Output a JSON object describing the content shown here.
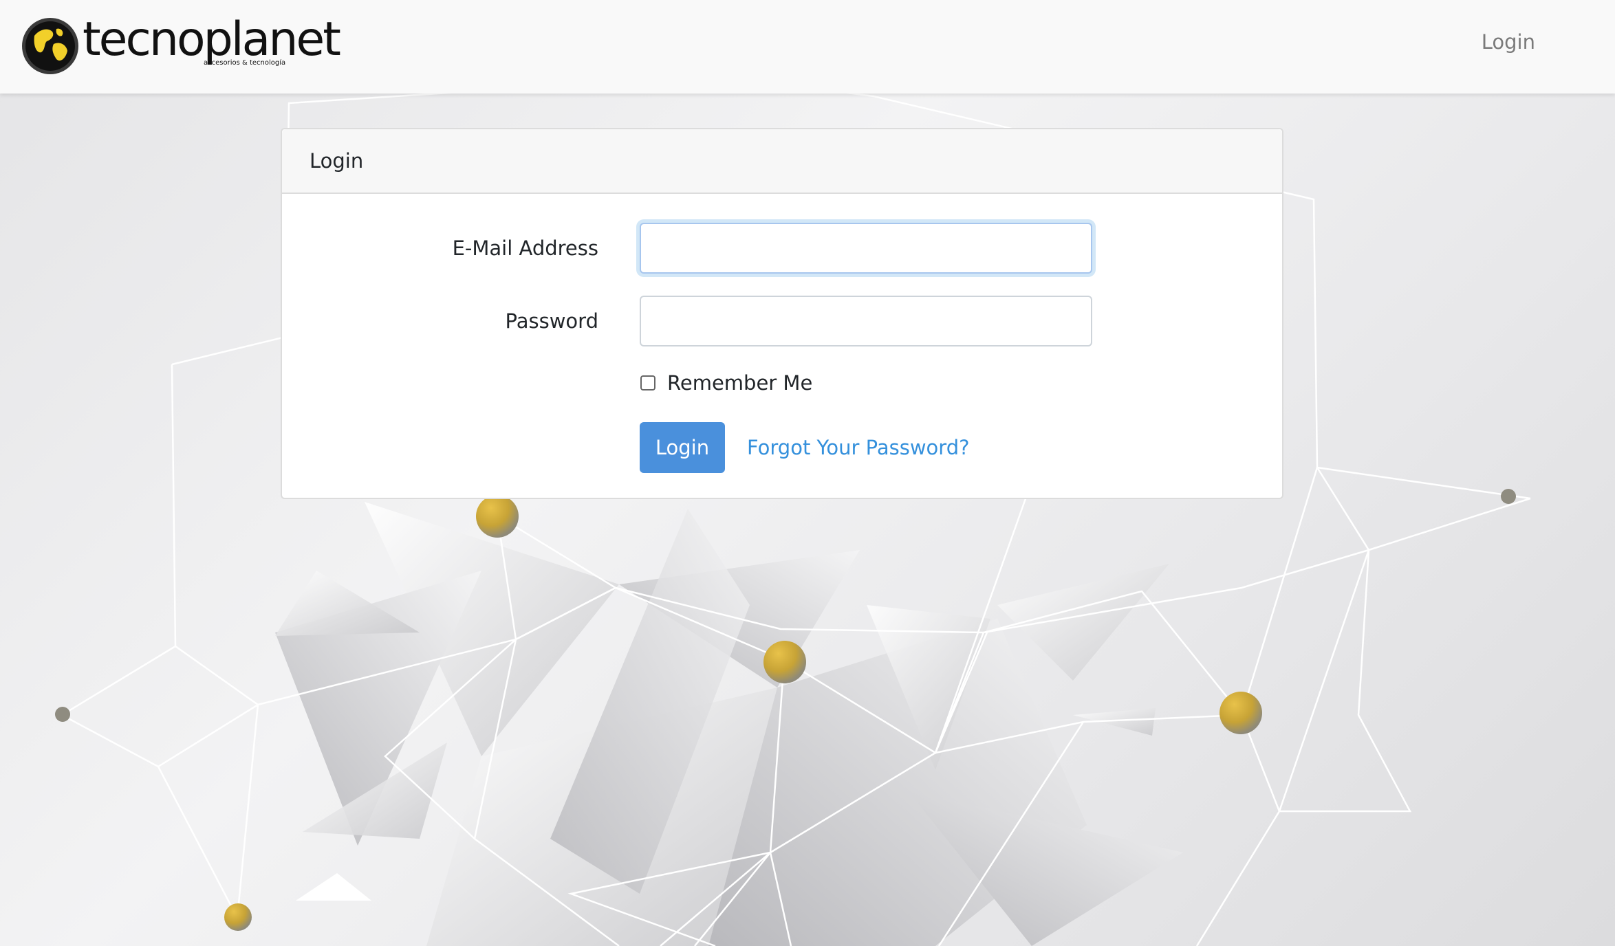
{
  "navbar": {
    "brand": "tecnoplanet",
    "tagline": "accesorios & tecnología",
    "login_link": "Login"
  },
  "card": {
    "title": "Login",
    "email_label": "E-Mail Address",
    "email_value": "",
    "password_label": "Password",
    "password_value": "",
    "remember_label": "Remember Me",
    "remember_checked": false,
    "login_button": "Login",
    "forgot_link": "Forgot Your Password?"
  },
  "colors": {
    "primary": "#4a90dc",
    "link": "#3490dc",
    "navbar_bg": "#f9f9f9",
    "node_gold": "#c9a83a"
  }
}
